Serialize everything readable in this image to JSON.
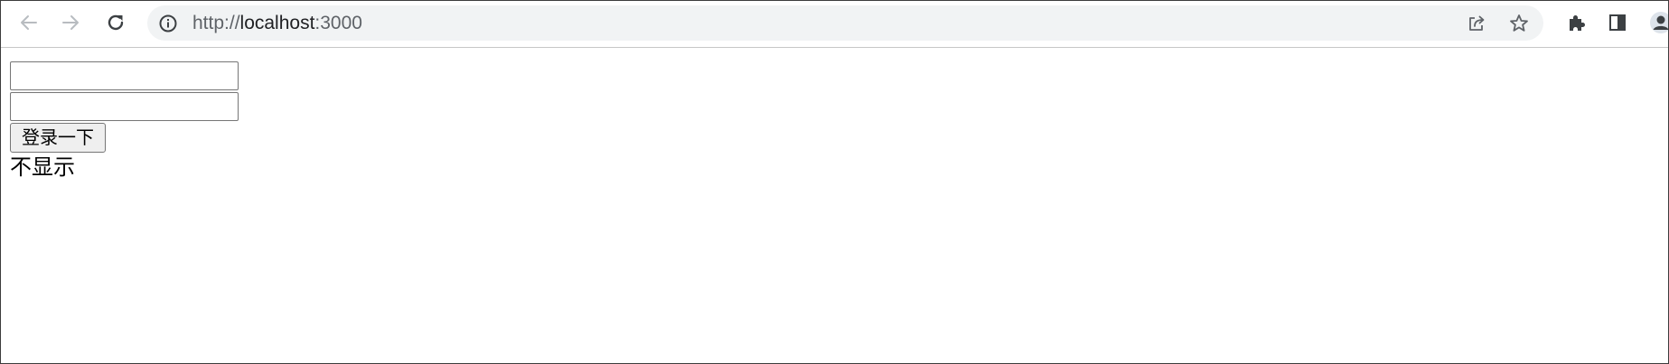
{
  "browser": {
    "url_scheme": "http://",
    "url_host": "localhost",
    "url_port": ":3000",
    "icons": {
      "back": "arrow-left-icon",
      "forward": "arrow-right-icon",
      "reload": "reload-icon",
      "site_info": "info-circle-icon",
      "share": "share-icon",
      "bookmark": "star-icon",
      "extensions": "puzzle-icon",
      "side_panel": "side-panel-icon",
      "profile": "avatar-icon"
    }
  },
  "page": {
    "username_value": "",
    "password_value": "",
    "login_button_label": "登录一下",
    "status_text": "不显示"
  },
  "colors": {
    "toolbar_icon": "#5f6368",
    "toolbar_icon_disabled": "#b8bcc0",
    "omnibox_bg": "#f1f3f4",
    "button_bg": "#efefef"
  }
}
